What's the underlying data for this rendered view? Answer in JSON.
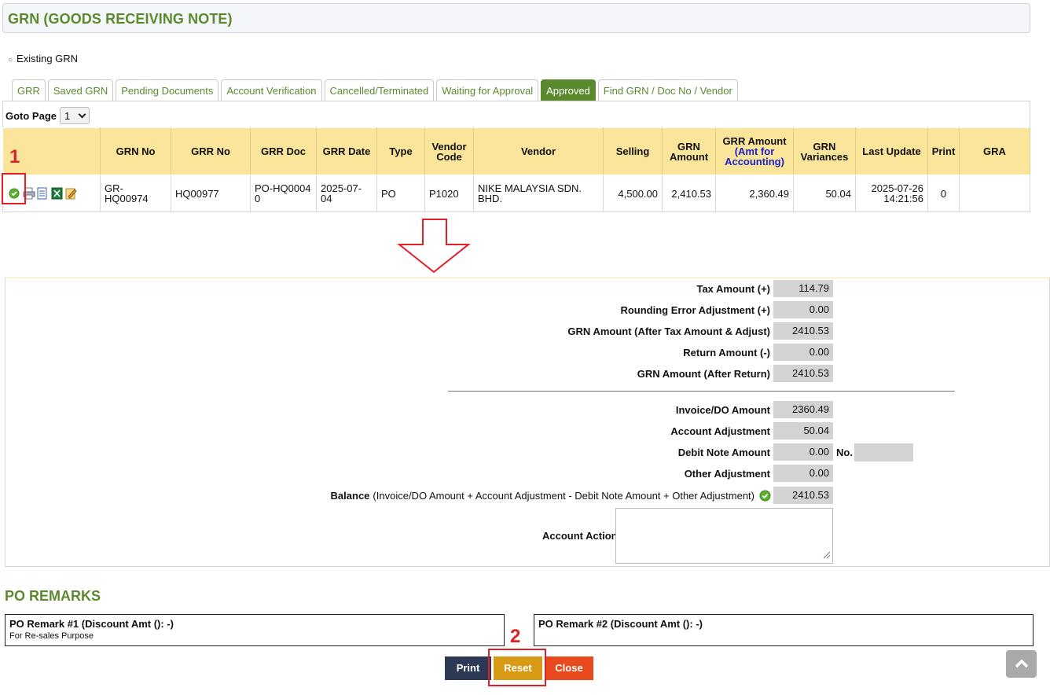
{
  "page": {
    "title": "GRN (GOODS RECEIVING NOTE)",
    "existing_label": "Existing GRN"
  },
  "tabs": [
    {
      "label": "GRR",
      "active": false
    },
    {
      "label": "Saved GRN",
      "active": false
    },
    {
      "label": "Pending Documents",
      "active": false
    },
    {
      "label": "Account Verification",
      "active": false
    },
    {
      "label": "Cancelled/Terminated",
      "active": false
    },
    {
      "label": "Waiting for Approval",
      "active": false
    },
    {
      "label": "Approved",
      "active": true
    },
    {
      "label": "Find GRN / Doc No / Vendor",
      "active": false
    }
  ],
  "goto": {
    "label": "Goto Page",
    "value": "1"
  },
  "table": {
    "headers": {
      "grn_no": "GRN No",
      "grr_no": "GRR No",
      "grr_doc": "GRR Doc",
      "grr_date": "GRR Date",
      "type": "Type",
      "vendor_code": "Vendor Code",
      "vendor": "Vendor",
      "selling": "Selling",
      "grn_amount": "GRN Amount",
      "grr_amount": "GRR Amount",
      "grr_amount_note": "(Amt for Accounting)",
      "grn_variances": "GRN Variances",
      "last_update": "Last Update",
      "print": "Print",
      "gra": "GRA"
    },
    "row": {
      "grn_no": "GR-HQ00974",
      "grr_no": "HQ00977",
      "grr_doc": "PO-HQ00040",
      "grr_date": "2025-07-04",
      "type": "PO",
      "vendor_code": "P1020",
      "vendor": "NIKE MALAYSIA SDN. BHD.",
      "selling": "4,500.00",
      "grn_amount": "2,410.53",
      "grr_amount": "2,360.49",
      "grn_variances": "50.04",
      "last_update": "2025-07-26 14:21:56",
      "print": "0",
      "gra": ""
    }
  },
  "annotations": {
    "marker1": "1",
    "marker2": "2"
  },
  "summary": {
    "tax_amount": {
      "label": "Tax Amount (+)",
      "value": "114.79"
    },
    "rounding": {
      "label": "Rounding Error Adjustment (+)",
      "value": "0.00"
    },
    "grn_after_tax": {
      "label": "GRN Amount (After Tax Amount & Adjust)",
      "value": "2410.53"
    },
    "return_amount": {
      "label": "Return Amount (-)",
      "value": "0.00"
    },
    "grn_after_return": {
      "label": "GRN Amount (After Return)",
      "value": "2410.53"
    },
    "invoice_do": {
      "label": "Invoice/DO Amount",
      "value": "2360.49"
    },
    "account_adjustment": {
      "label": "Account Adjustment",
      "value": "50.04"
    },
    "debit_note": {
      "label": "Debit Note Amount",
      "value": "0.00",
      "no_label": "No.",
      "no_value": ""
    },
    "other_adjustment": {
      "label": "Other Adjustment",
      "value": "0.00"
    },
    "balance": {
      "label": "Balance",
      "formula": "(Invoice/DO Amount + Account Adjustment - Debit Note Amount + Other Adjustment)",
      "value": "2410.53"
    },
    "account_action": {
      "label": "Account Action",
      "value": ""
    }
  },
  "po_remarks": {
    "title": "PO REMARKS",
    "remark1": {
      "title": "PO Remark #1 (Discount Amt (): -)",
      "text": "For Re-sales Purpose"
    },
    "remark2": {
      "title": "PO Remark #2 (Discount Amt (): -)",
      "text": ""
    }
  },
  "buttons": {
    "print": "Print",
    "reset": "Reset",
    "close": "Close"
  },
  "colors": {
    "brand_green": "#5b8a2e",
    "header_yellow": "#fbe59a",
    "print_btn": "#2c3a55",
    "reset_btn": "#d99a16",
    "close_btn": "#e8491d",
    "annotation_red": "#e11f26"
  }
}
